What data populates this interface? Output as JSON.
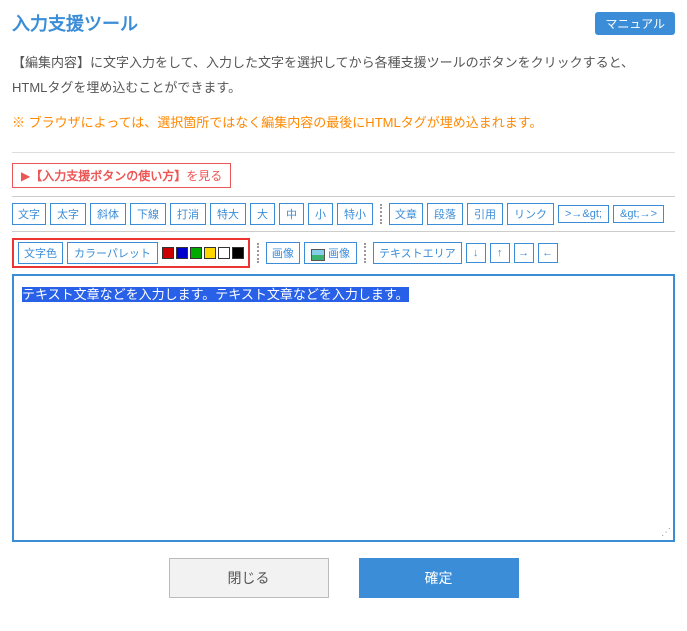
{
  "header": {
    "title": "入力支援ツール",
    "manual": "マニュアル"
  },
  "description": "【編集内容】に文字入力をして、入力した文字を選択してから各種支援ツールのボタンをクリックすると、\nHTMLタグを埋め込むことができます。",
  "warning": "※ ブラウザによっては、選択箇所ではなく編集内容の最後にHTMLタグが埋め込まれます。",
  "help_link": {
    "prefix": "▶",
    "bold": "【入力支援ボタンの使い方】",
    "suffix": "を見る"
  },
  "toolbar": {
    "row1": {
      "label_moji": "文字",
      "bold": "太字",
      "italic": "斜体",
      "underline": "下線",
      "strike": "打消",
      "xlarge": "特大",
      "large": "大",
      "medium": "中",
      "small": "小",
      "xsmall": "特小",
      "label_bunsho": "文章",
      "para": "段落",
      "quote": "引用",
      "link": "リンク",
      "gt1": ">→&gt;",
      "gt2": "&gt;→>"
    },
    "row2": {
      "label_color": "文字色",
      "palette": "カラーパレット",
      "label_img": "画像",
      "img_btn": "画像",
      "label_textarea": "テキストエリア"
    }
  },
  "colors": [
    "#c00",
    "#00c",
    "#0a0",
    "#ffd700",
    "#fff",
    "#000"
  ],
  "arrows": [
    "↓",
    "↑",
    "→",
    "←"
  ],
  "editor": {
    "content": "テキスト文章などを入力します。テキスト文章などを入力します。"
  },
  "buttons": {
    "close": "閉じる",
    "confirm": "確定"
  }
}
